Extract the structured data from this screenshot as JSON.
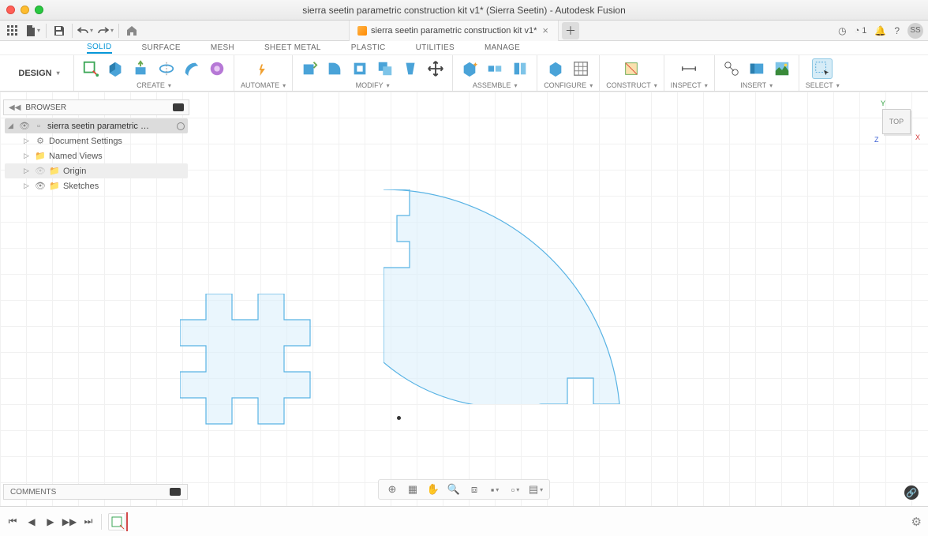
{
  "window": {
    "title": "sierra seetin parametric construction kit v1* (Sierra Seetin) - Autodesk Fusion"
  },
  "docTab": {
    "name": "sierra seetin parametric construction kit v1*"
  },
  "qatRight": {
    "jobCount": "1",
    "avatar": "SS"
  },
  "ribbonTabs": [
    "SOLID",
    "SURFACE",
    "MESH",
    "SHEET METAL",
    "PLASTIC",
    "UTILITIES",
    "MANAGE"
  ],
  "design": {
    "label": "DESIGN"
  },
  "groups": {
    "create": "CREATE",
    "automate": "AUTOMATE",
    "modify": "MODIFY",
    "assemble": "ASSEMBLE",
    "configure": "CONFIGURE",
    "construct": "CONSTRUCT",
    "inspect": "INSPECT",
    "insert": "INSERT",
    "select": "SELECT"
  },
  "browser": {
    "title": "BROWSER",
    "root": "sierra seetin parametric con...",
    "items": [
      "Document Settings",
      "Named Views",
      "Origin",
      "Sketches"
    ]
  },
  "viewcube": {
    "face": "TOP",
    "y": "Y",
    "x": "X",
    "z": "Z"
  },
  "comments": {
    "label": "COMMENTS"
  }
}
